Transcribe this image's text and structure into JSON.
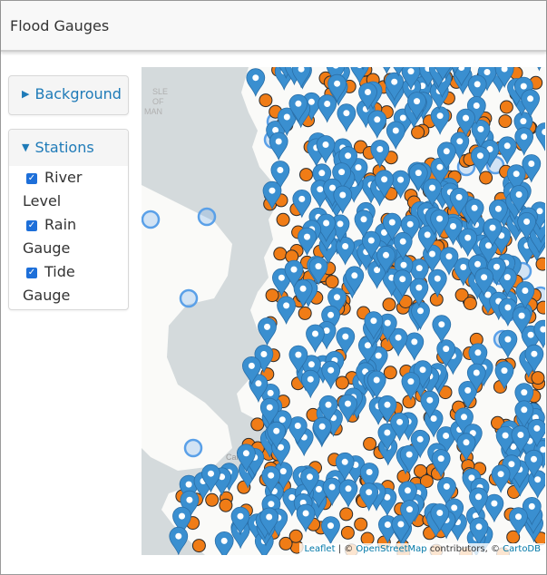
{
  "header": {
    "title": "Flood Gauges"
  },
  "background_panel": {
    "label": "Background",
    "caret": "▶"
  },
  "stations_panel": {
    "label": "Stations",
    "caret": "▼",
    "layers": [
      {
        "line1": "River",
        "line2": "Level",
        "checked": true
      },
      {
        "line1": "Rain",
        "line2": "Gauge",
        "checked": true
      },
      {
        "line1": "Tide",
        "line2": "Gauge",
        "checked": true
      }
    ]
  },
  "map": {
    "colors": {
      "sea": "#d4dadc",
      "land": "#fafaf8",
      "marker": "#3a8fd0",
      "rain": "#f07c16",
      "tide": "#5aa0e8"
    },
    "attribution": {
      "leaflet": "Leaflet",
      "osm": "OpenStreetMap",
      "contributors": "contributors, ©",
      "carto": "CartoDB"
    },
    "labels": {
      "isle_1": "SLE",
      "isle_2": "OF",
      "isle_3": "MAN",
      "cardiff": "Cardiff"
    }
  }
}
